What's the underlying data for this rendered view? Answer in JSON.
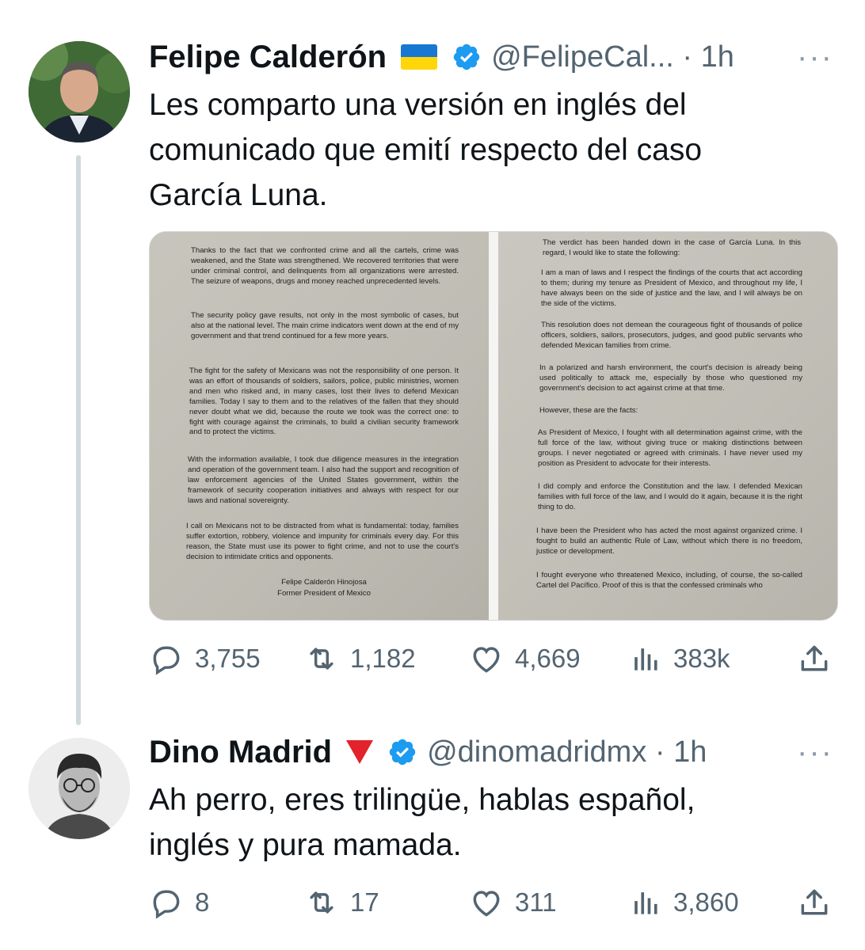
{
  "tweet1": {
    "name": "Felipe Calderón",
    "handle": "@FelipeCal... · 1h",
    "text_line1": "Les comparto una versión en inglés del",
    "text_line2": "comunicado que emití respecto del caso",
    "text_line3": "García Luna.",
    "more": "···",
    "stats": {
      "replies": "3,755",
      "retweets": "1,182",
      "likes": "4,669",
      "views": "383k"
    },
    "document_left": [
      "Thanks to the fact that we confronted crime and all the cartels, crime was weakened, and the State was strengthened. We recovered territories that were under criminal control, and delinquents from all organizations were arrested. The seizure of weapons, drugs and money reached unprecedented levels.",
      "The security policy gave results, not only in the most symbolic of cases, but also at the national level. The main crime indicators went down at the end of my government and that trend continued for a few more years.",
      "The fight for the safety of Mexicans was not the responsibility of one person. It was an effort of thousands of soldiers, sailors, police, public ministries, women and men who risked and, in many cases, lost their lives to defend Mexican families. Today I say to them and to the relatives of the fallen that they should never doubt what we did, because the route we took was the correct one: to fight with courage against the criminals, to build a civilian security framework and to protect the victims.",
      "With the information available, I took due diligence measures in the integration and operation of the government team. I also had the support and recognition of law enforcement agencies of the United States government, within the framework of security cooperation initiatives and always with respect for our laws and national sovereignty.",
      "I call on Mexicans not to be distracted from what is fundamental: today, families suffer extortion, robbery, violence and impunity for criminals every day. For this reason, the State must use its power to fight crime, and not to use the court's decision to intimidate critics and opponents."
    ],
    "signature_name": "Felipe Calderón Hinojosa",
    "signature_title": "Former President of Mexico",
    "document_right": [
      "The verdict has been handed down in the case of García Luna. In this regard, I would like to state the following:",
      "I am a man of laws and I respect the findings of the courts that act according to them; during my tenure as President of Mexico, and throughout my life, I have always been on the side of justice and the law, and I will always be on the side of the victims.",
      "This resolution does not demean the courageous fight of thousands of police officers, soldiers, sailors, prosecutors, judges, and good public servants who defended Mexican families from crime.",
      "In a polarized and harsh environment, the court's decision is already being used politically to attack me, especially by those who questioned my government's decision to act against crime at that time.",
      "However, these are the facts:",
      "As President of Mexico, I fought with all determination against crime, with the full force of the law, without giving truce or making distinctions between groups. I never negotiated or agreed with criminals. I have never used my position as President to advocate for their interests.",
      "I did comply and enforce the Constitution and the law. I defended Mexican families with full force of the law, and I would do it again, because it is the right thing to do.",
      "I have been the President who has acted the most against organized crime. I fought to build an authentic Rule of Law, without which there is no freedom, justice or development.",
      "I fought everyone who threatened Mexico, including, of course, the so-called Cartel del Pacífico. Proof of this is that the confessed criminals who"
    ]
  },
  "tweet2": {
    "name": "Dino Madrid",
    "handle": "@dinomadridmx · 1h",
    "text_line1": "Ah perro, eres trilingüe, hablas español,",
    "text_line2": "inglés y pura mamada.",
    "more": "···",
    "stats": {
      "replies": "8",
      "retweets": "17",
      "likes": "311",
      "views": "3,860"
    }
  },
  "colors": {
    "verified": "#1d9bf0",
    "muted": "#536471",
    "thread_line": "#cfd9de"
  },
  "icons": [
    "reply-icon",
    "retweet-icon",
    "like-icon",
    "views-icon",
    "share-icon",
    "verified-badge-icon",
    "ukraine-flag-icon",
    "red-triangle-icon"
  ]
}
